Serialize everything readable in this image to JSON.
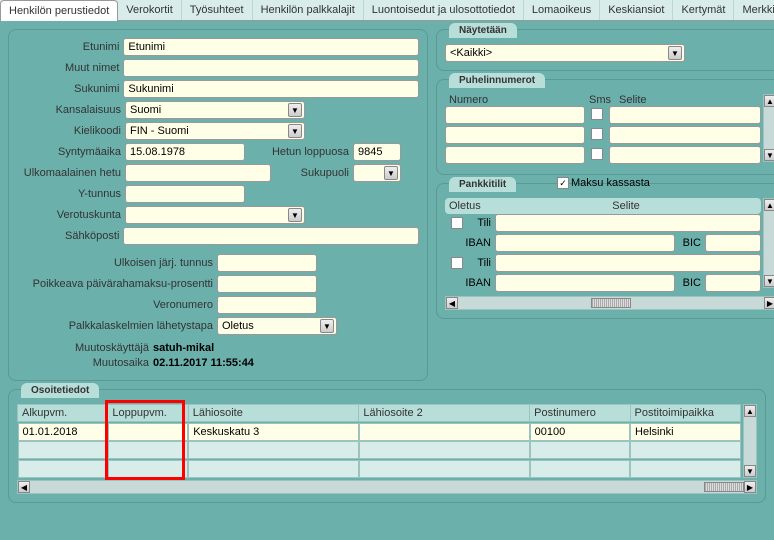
{
  "tabs": [
    "Henkilön perustiedot",
    "Verokortit",
    "Työsuhteet",
    "Henkilön palkkalajit",
    "Luontoisedut ja ulosottotiedot",
    "Lomaoikeus",
    "Keskiansiot",
    "Kertymät",
    "Merkkipäivät"
  ],
  "activeTab": 0,
  "person": {
    "labels": {
      "etunimi": "Etunimi",
      "muut": "Muut nimet",
      "sukunimi": "Sukunimi",
      "kansalaisuus": "Kansalaisuus",
      "kielikoodi": "Kielikoodi",
      "syntyma": "Syntymäaika",
      "hetunloppu": "Hetun loppuosa",
      "ulkomhetu": "Ulkomaalainen hetu",
      "sukupuoli": "Sukupuoli",
      "ytunnus": "Y-tunnus",
      "verotuskunta": "Verotuskunta",
      "sahkoposti": "Sähköposti",
      "ulktunnus": "Ulkoisen järj. tunnus",
      "poikkeava": "Poikkeava päivärahamaksu-prosentti",
      "veronumero": "Veronumero",
      "lahetystapa": "Palkkalaskelmien lähetystapa",
      "muutoskayttaja": "Muutoskäyttäjä",
      "muutosaika": "Muutosaika"
    },
    "values": {
      "etunimi": "Etunimi",
      "muut": "",
      "sukunimi": "Sukunimi",
      "kansalaisuus": "Suomi",
      "kielikoodi": "FIN - Suomi",
      "syntyma": "15.08.1978",
      "hetunloppu": "9845",
      "ulkomhetu": "",
      "sukupuoli": "",
      "ytunnus": "",
      "verotuskunta": "",
      "sahkoposti": "",
      "ulktunnus": "",
      "poikkeava": "",
      "veronumero": "",
      "lahetystapa": "Oletus",
      "muutoskayttaja": "satuh-mikal",
      "muutosaika": "02.11.2017 11:55:44"
    }
  },
  "naytetaan": {
    "title": "Näytetään",
    "value": "<Kaikki>"
  },
  "puhelin": {
    "title": "Puhelinnumerot",
    "cols": {
      "numero": "Numero",
      "sms": "Sms",
      "selite": "Selite"
    },
    "rows": [
      {
        "numero": "",
        "sms": false,
        "selite": ""
      },
      {
        "numero": "",
        "sms": false,
        "selite": ""
      },
      {
        "numero": "",
        "sms": false,
        "selite": ""
      }
    ]
  },
  "pankki": {
    "title": "Pankkitilit",
    "maksu": "Maksu kassasta",
    "maksu_checked": true,
    "cols": {
      "oletus": "Oletus",
      "tili": "Tili",
      "iban": "IBAN",
      "bic": "BIC",
      "selite": "Selite"
    },
    "rows": [
      {
        "oletus": false,
        "tili": "",
        "iban": "",
        "bic": "",
        "selite": ""
      },
      {
        "oletus": false,
        "tili": "",
        "iban": "",
        "bic": "",
        "selite": ""
      }
    ]
  },
  "osoite": {
    "title": "Osoitetiedot",
    "cols": {
      "alku": "Alkupvm.",
      "loppu": "Loppupvm.",
      "lahi": "Lähiosoite",
      "lahi2": "Lähiosoite 2",
      "posti": "Postinumero",
      "kaupunki": "Postitoimipaikka"
    },
    "rows": [
      {
        "alku": "01.01.2018",
        "loppu": "",
        "lahi": "Keskuskatu 3",
        "lahi2": "",
        "posti": "00100",
        "kaupunki": "Helsinki"
      },
      {
        "alku": "",
        "loppu": "",
        "lahi": "",
        "lahi2": "",
        "posti": "",
        "kaupunki": ""
      },
      {
        "alku": "",
        "loppu": "",
        "lahi": "",
        "lahi2": "",
        "posti": "",
        "kaupunki": ""
      }
    ]
  }
}
